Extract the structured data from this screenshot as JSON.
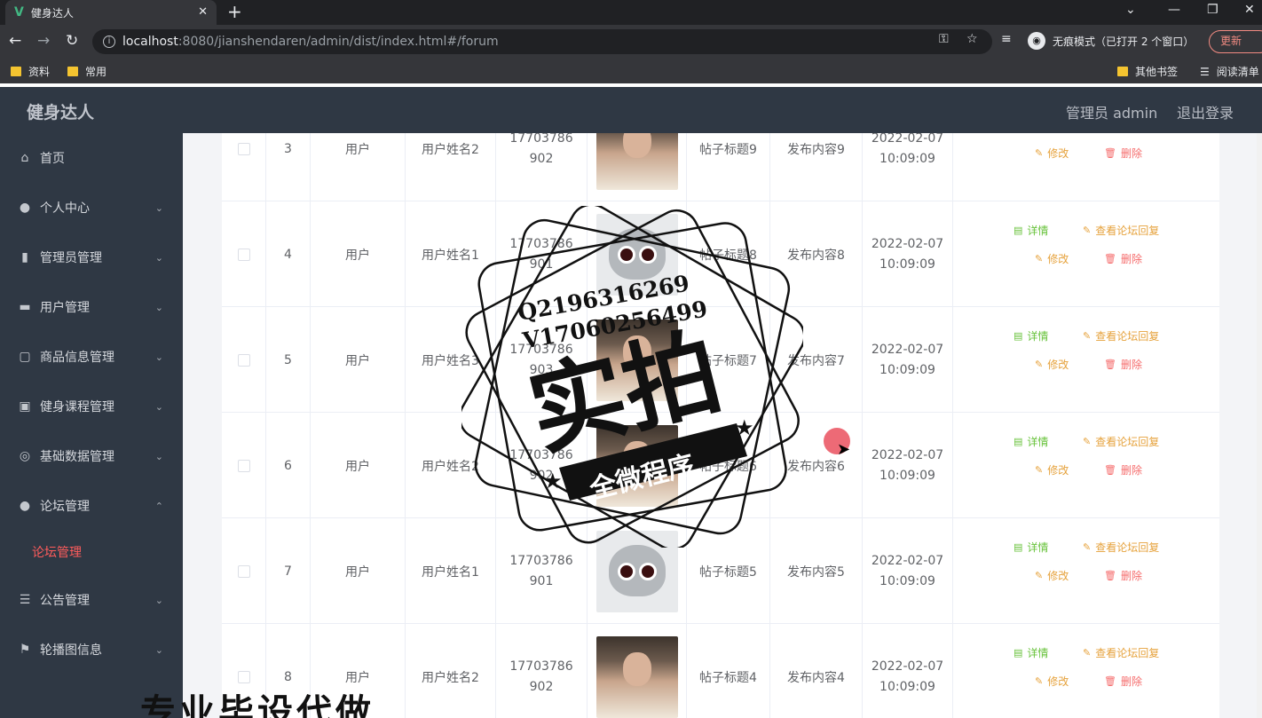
{
  "browser": {
    "tab_title": "健身达人",
    "tab_close": "✕",
    "new_tab": "+",
    "url_host": "localhost",
    "url_path": ":8080/jianshendaren/admin/dist/index.html#/forum",
    "incognito_label": "无痕模式（已打开 2 个窗口）",
    "update_label": "更新",
    "bookmarks": [
      "资料",
      "常用"
    ],
    "other_bookmarks": "其他书签",
    "reading_list": "阅读清单"
  },
  "app": {
    "title": "健身达人",
    "admin_label": "管理员 admin",
    "logout_label": "退出登录"
  },
  "sidebar": {
    "items": [
      {
        "label": "首页",
        "icon": "home-icon"
      },
      {
        "label": "个人中心",
        "icon": "user-icon"
      },
      {
        "label": "管理员管理",
        "icon": "bar-chart-icon"
      },
      {
        "label": "用户管理",
        "icon": "ticket-icon"
      },
      {
        "label": "商品信息管理",
        "icon": "chat-icon"
      },
      {
        "label": "健身课程管理",
        "icon": "briefcase-icon"
      },
      {
        "label": "基础数据管理",
        "icon": "settings-icon"
      },
      {
        "label": "论坛管理",
        "icon": "user-icon"
      },
      {
        "label": "公告管理",
        "icon": "list-icon"
      },
      {
        "label": "轮播图信息",
        "icon": "flag-icon"
      }
    ],
    "active_sub": "论坛管理"
  },
  "table": {
    "rows": [
      {
        "index": "3",
        "role": "用户",
        "name": "用户姓名2",
        "phone": "17703786902",
        "title": "帖子标题9",
        "content": "发布内容9",
        "date": "2022-02-07",
        "time": "10:09:09",
        "image": "person"
      },
      {
        "index": "4",
        "role": "用户",
        "name": "用户姓名1",
        "phone": "17703786901",
        "title": "帖子标题8",
        "content": "发布内容8",
        "date": "2022-02-07",
        "time": "10:09:09",
        "image": "cat"
      },
      {
        "index": "5",
        "role": "用户",
        "name": "用户姓名3",
        "phone": "17703786903",
        "title": "帖子标题7",
        "content": "发布内容7",
        "date": "2022-02-07",
        "time": "10:09:09",
        "image": "person"
      },
      {
        "index": "6",
        "role": "用户",
        "name": "用户姓名2",
        "phone": "17703786902",
        "title": "帖子标题6",
        "content": "发布内容6",
        "date": "2022-02-07",
        "time": "10:09:09",
        "image": "person"
      },
      {
        "index": "7",
        "role": "用户",
        "name": "用户姓名1",
        "phone": "17703786901",
        "title": "帖子标题5",
        "content": "发布内容5",
        "date": "2022-02-07",
        "time": "10:09:09",
        "image": "cat"
      },
      {
        "index": "8",
        "role": "用户",
        "name": "用户姓名2",
        "phone": "17703786902",
        "title": "帖子标题4",
        "content": "发布内容4",
        "date": "2022-02-07",
        "time": "10:09:09",
        "image": "person"
      }
    ],
    "ops": {
      "detail": "详情",
      "reply": "查看论坛回复",
      "edit": "修改",
      "delete": "删除"
    }
  },
  "watermark": {
    "qq": "Q2196316269",
    "wx": "V17060256499",
    "big": "实拍",
    "banner": "全微程序",
    "bottom": "专业毕设代做"
  }
}
